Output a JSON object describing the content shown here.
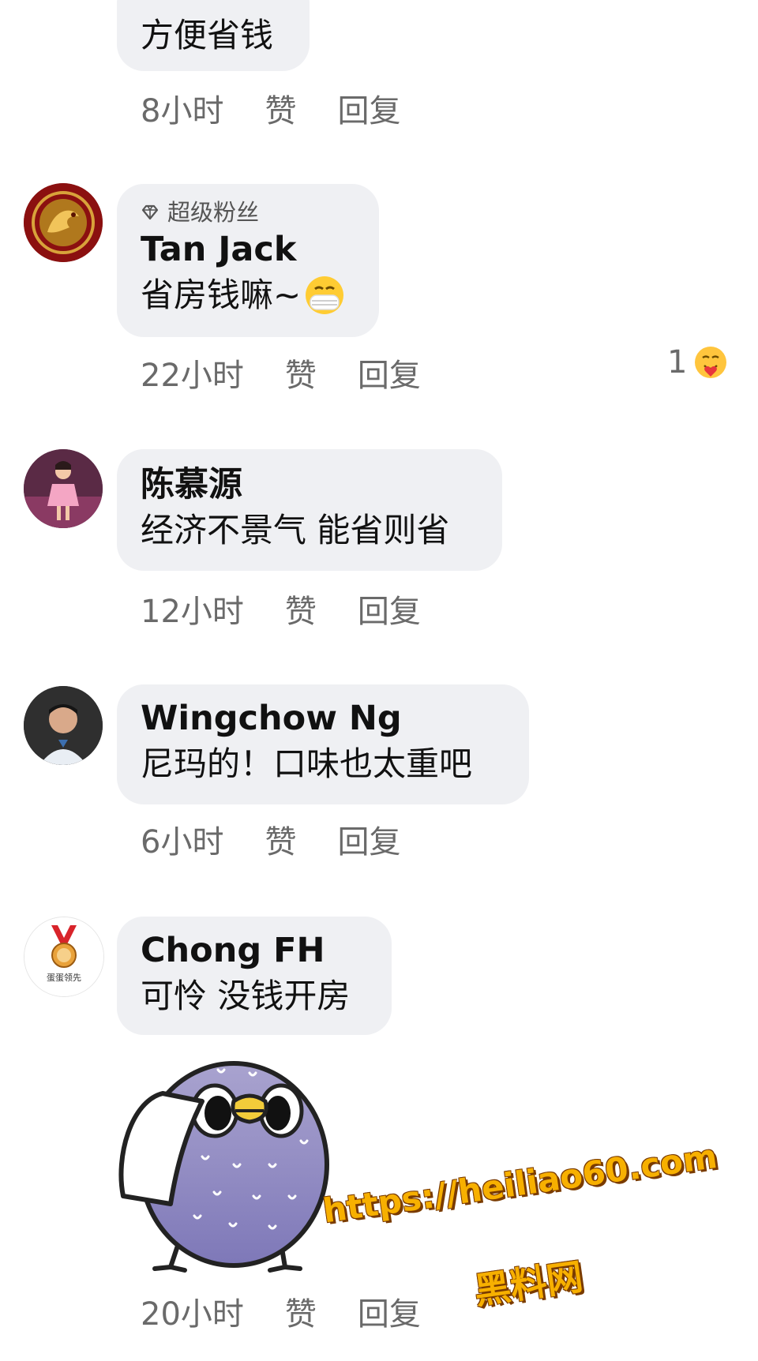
{
  "comments": [
    {
      "text": "方便省钱",
      "time": "8小时",
      "like_label": "赞",
      "reply_label": "回复"
    },
    {
      "badge": "超级粉丝",
      "name": "Tan Jack",
      "text": "省房钱嘛~",
      "time": "22小时",
      "like_label": "赞",
      "reply_label": "回复",
      "reaction_count": "1"
    },
    {
      "name": "陈慕源",
      "text": "经济不景气 能省则省",
      "time": "12小时",
      "like_label": "赞",
      "reply_label": "回复"
    },
    {
      "name": "Wingchow Ng",
      "text": "尼玛的！口味也太重吧",
      "time": "6小时",
      "like_label": "赞",
      "reply_label": "回复"
    },
    {
      "name": "Chong FH",
      "text": "可怜 没钱开房",
      "avatar_text": "蛋蛋领先",
      "time": "20小时",
      "like_label": "赞",
      "reply_label": "回复"
    }
  ],
  "watermark": {
    "url": "https://heiliao60.com",
    "site": "黑料网"
  },
  "colors": {
    "bubble": "#eff0f3",
    "meta_text": "#6a6a6a",
    "watermark": "#f7b000"
  }
}
